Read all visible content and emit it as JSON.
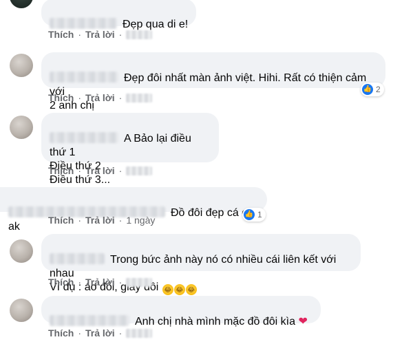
{
  "actions": {
    "like": "Thích",
    "reply": "Trả lời",
    "dot": "·"
  },
  "comments": [
    {
      "text": "Đẹp qua di e!"
    },
    {
      "text": "Đẹp đôi nhất màn ảnh việt. Hihi. Rất có thiện cảm với\n2 anh chị",
      "reactions": "2"
    },
    {
      "text": "A Bảo lại điều thứ 1\nĐiều thứ 2\nĐiều thứ 3..."
    },
    {
      "text": "Đồ đôi đẹp cá c ak",
      "reactions": "1",
      "time": "1 ngày"
    },
    {
      "text": "Trong bức ảnh này nó có nhiều cái liên kết với nhau\nVí dụ : áo đôi, giày đôi"
    },
    {
      "text": "Anh chị nhà mình mặc đồ đôi kìa"
    }
  ],
  "colors": {
    "bubble": "#f0f2f5",
    "meta": "#65676b",
    "like": "#1877f2",
    "heart": "#e0245e"
  },
  "icons": {
    "like": "like-icon",
    "laugh": "laughing-emoji",
    "heart": "heart-emoji"
  }
}
